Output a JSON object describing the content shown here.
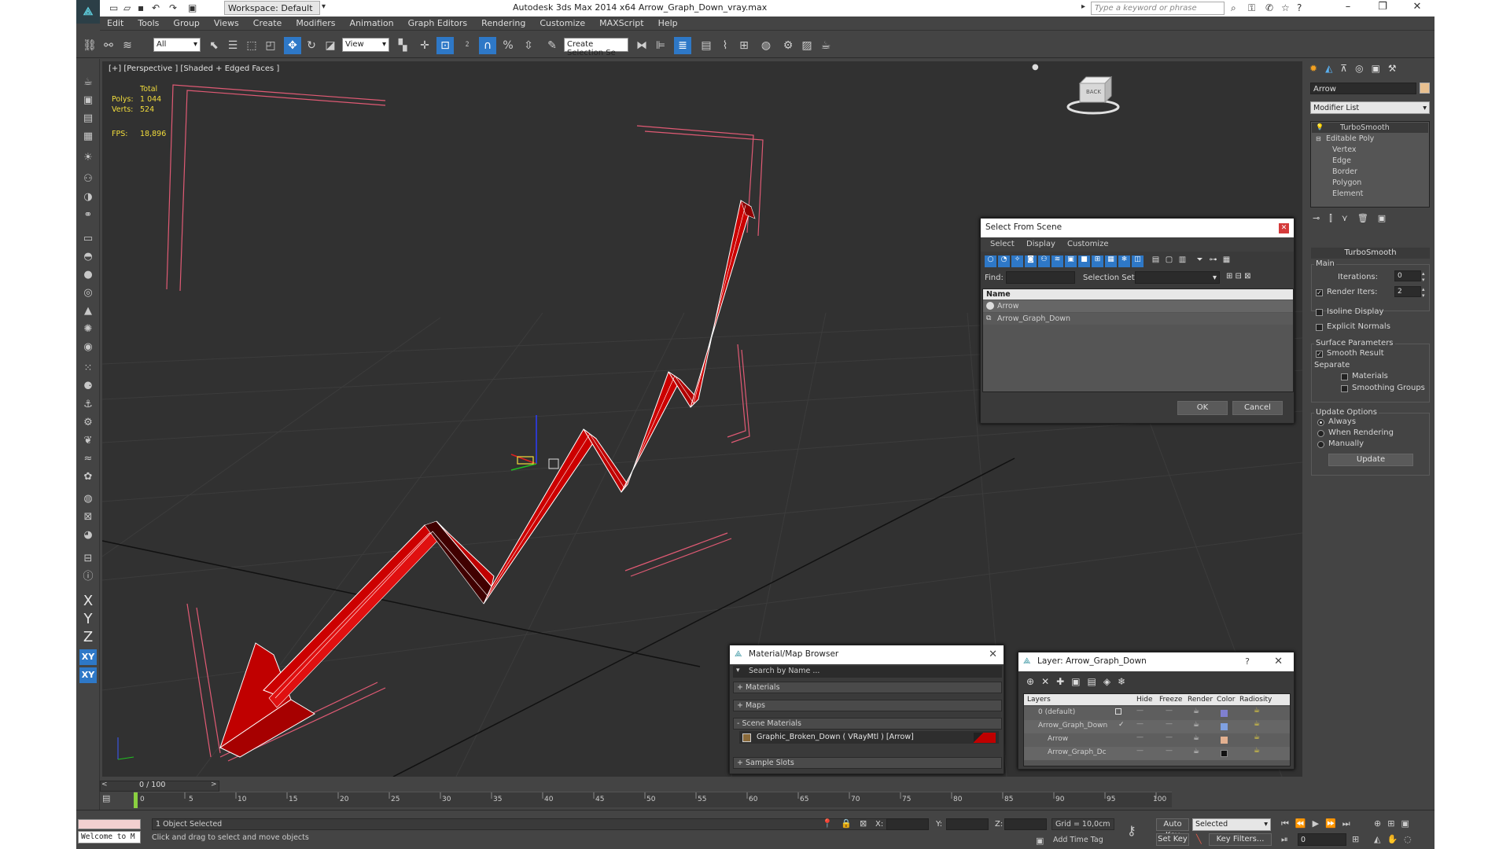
{
  "window": {
    "title": "Autodesk 3ds Max  2014 x64     Arrow_Graph_Down_vray.max",
    "workspace": "Workspace: Default",
    "search_placeholder": "Type a keyword or phrase"
  },
  "menu": [
    "Edit",
    "Tools",
    "Group",
    "Views",
    "Create",
    "Modifiers",
    "Animation",
    "Graph Editors",
    "Rendering",
    "Customize",
    "MAXScript",
    "Help"
  ],
  "toolbar": {
    "filter": "All",
    "ref_coord": "View",
    "selection_set": "Create Selection Se"
  },
  "viewport": {
    "label": "[+] [Perspective ] [Shaded + Edged Faces ]",
    "stats": {
      "total_label": "Total",
      "polys_label": "Polys:",
      "polys": "1 044",
      "verts_label": "Verts:",
      "verts": "524",
      "fps_label": "FPS:",
      "fps": "18,896"
    },
    "viewcube_label": "BACK"
  },
  "left_toolbar": {
    "x": "X",
    "y": "Y",
    "z": "Z",
    "xy": "XY",
    "xy2": "XY"
  },
  "command_panel": {
    "object_name": "Arrow",
    "modifier_list": "Modifier List",
    "stack": [
      {
        "label": "TurboSmooth",
        "level": 0
      },
      {
        "label": "Editable Poly",
        "level": 0
      },
      {
        "label": "Vertex",
        "level": 1
      },
      {
        "label": "Edge",
        "level": 1
      },
      {
        "label": "Border",
        "level": 1
      },
      {
        "label": "Polygon",
        "level": 1
      },
      {
        "label": "Element",
        "level": 1
      }
    ],
    "turbosmooth": {
      "title": "TurboSmooth",
      "main": "Main",
      "iterations_label": "Iterations:",
      "iterations": "0",
      "render_iters_label": "Render Iters:",
      "render_iters": "2",
      "isoline": "Isoline Display",
      "explicit": "Explicit Normals",
      "surface_params": "Surface Parameters",
      "smooth_result": "Smooth Result",
      "separate": "Separate",
      "materials": "Materials",
      "smoothing_groups": "Smoothing Groups",
      "update_options": "Update Options",
      "always": "Always",
      "when_rendering": "When Rendering",
      "manually": "Manually",
      "update": "Update"
    }
  },
  "select_dialog": {
    "title": "Select From Scene",
    "tabs": [
      "Select",
      "Display",
      "Customize"
    ],
    "find_label": "Find:",
    "selection_set_label": "Selection Set:",
    "col_name": "Name",
    "items": [
      "Arrow",
      "Arrow_Graph_Down"
    ],
    "ok": "OK",
    "cancel": "Cancel"
  },
  "material_browser": {
    "title": "Material/Map Browser",
    "search": "Search by Name ...",
    "sections": [
      "+ Materials",
      "+ Maps",
      "- Scene Materials",
      "+ Sample Slots"
    ],
    "scene_material": "Graphic_Broken_Down  ( VRayMtl )  [Arrow]"
  },
  "layer_dialog": {
    "title": "Layer: Arrow_Graph_Down",
    "help": "?",
    "columns": [
      "Layers",
      "Hide",
      "Freeze",
      "Render",
      "Color",
      "Radiosity"
    ],
    "rows": [
      {
        "name": "0 (default)",
        "color": "#8080d0"
      },
      {
        "name": "Arrow_Graph_Down",
        "color": "#7fa0e0"
      },
      {
        "name": "Arrow",
        "color": "#e2b090"
      },
      {
        "name": "Arrow_Graph_Dc",
        "color": "#111111"
      }
    ]
  },
  "timeline": {
    "frame": "0 / 100",
    "ticks": [
      "0",
      "5",
      "10",
      "15",
      "20",
      "25",
      "30",
      "35",
      "40",
      "45",
      "50",
      "55",
      "60",
      "65",
      "70",
      "75",
      "80",
      "85",
      "90",
      "95",
      "100"
    ]
  },
  "status": {
    "maxscript": "Welcome to M",
    "selected": "1 Object Selected",
    "prompt": "Click and drag to select and move objects",
    "x_label": "X:",
    "y_label": "Y:",
    "z_label": "Z:",
    "grid": "Grid = 10,0cm",
    "add_time_tag": "Add Time Tag",
    "auto_key": "Auto Key",
    "set_key": "Set Key",
    "key_mode": "Selected",
    "key_filters": "Key Filters...",
    "frame": "0"
  }
}
